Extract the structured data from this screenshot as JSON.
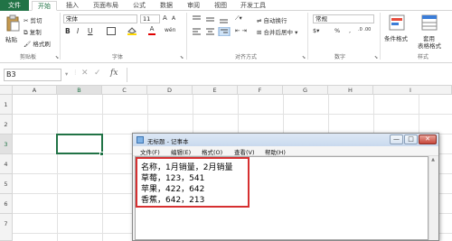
{
  "colors": {
    "accent": "#217346",
    "highlight": "#d63031"
  },
  "tabs": [
    "文件",
    "开始",
    "插入",
    "页面布局",
    "公式",
    "数据",
    "审阅",
    "视图",
    "开发工具"
  ],
  "clipboard": {
    "paste": "粘贴",
    "cut": "剪切",
    "copy": "复制",
    "painter": "格式刷",
    "group": "剪贴板"
  },
  "font": {
    "name": "宋体",
    "size": "11",
    "group": "字体",
    "bold": "B",
    "italic": "I",
    "underline": "U",
    "grow": "A",
    "shrink": "A",
    "color_a": "A",
    "phonetic": "wén"
  },
  "align": {
    "wrap": "自动换行",
    "merge": "合并后居中",
    "group": "对齐方式"
  },
  "number": {
    "format": "常规",
    "percent": "%",
    "comma": ",",
    "group": "数字"
  },
  "styles": {
    "conditional": "条件格式",
    "table": "套用",
    "table2": "表格格式",
    "group": "样式"
  },
  "formula_bar": {
    "namebox": "B3",
    "fx": "fx",
    "cancel": "✕",
    "confirm": "✓"
  },
  "columns": [
    "A",
    "B",
    "C",
    "D",
    "E",
    "F",
    "G",
    "H",
    "I"
  ],
  "rows": [
    "1",
    "2",
    "3",
    "4",
    "5",
    "6",
    "7"
  ],
  "notepad": {
    "title": "无标题 - 记事本",
    "menu": [
      "文件(F)",
      "编辑(E)",
      "格式(O)",
      "查看(V)",
      "帮助(H)"
    ],
    "lines": [
      "名称，1月销量，2月销量",
      "草莓，123，541",
      "苹果，422，642",
      "香蕉，642，213"
    ],
    "min": "—",
    "max": "□",
    "close": "✕"
  }
}
